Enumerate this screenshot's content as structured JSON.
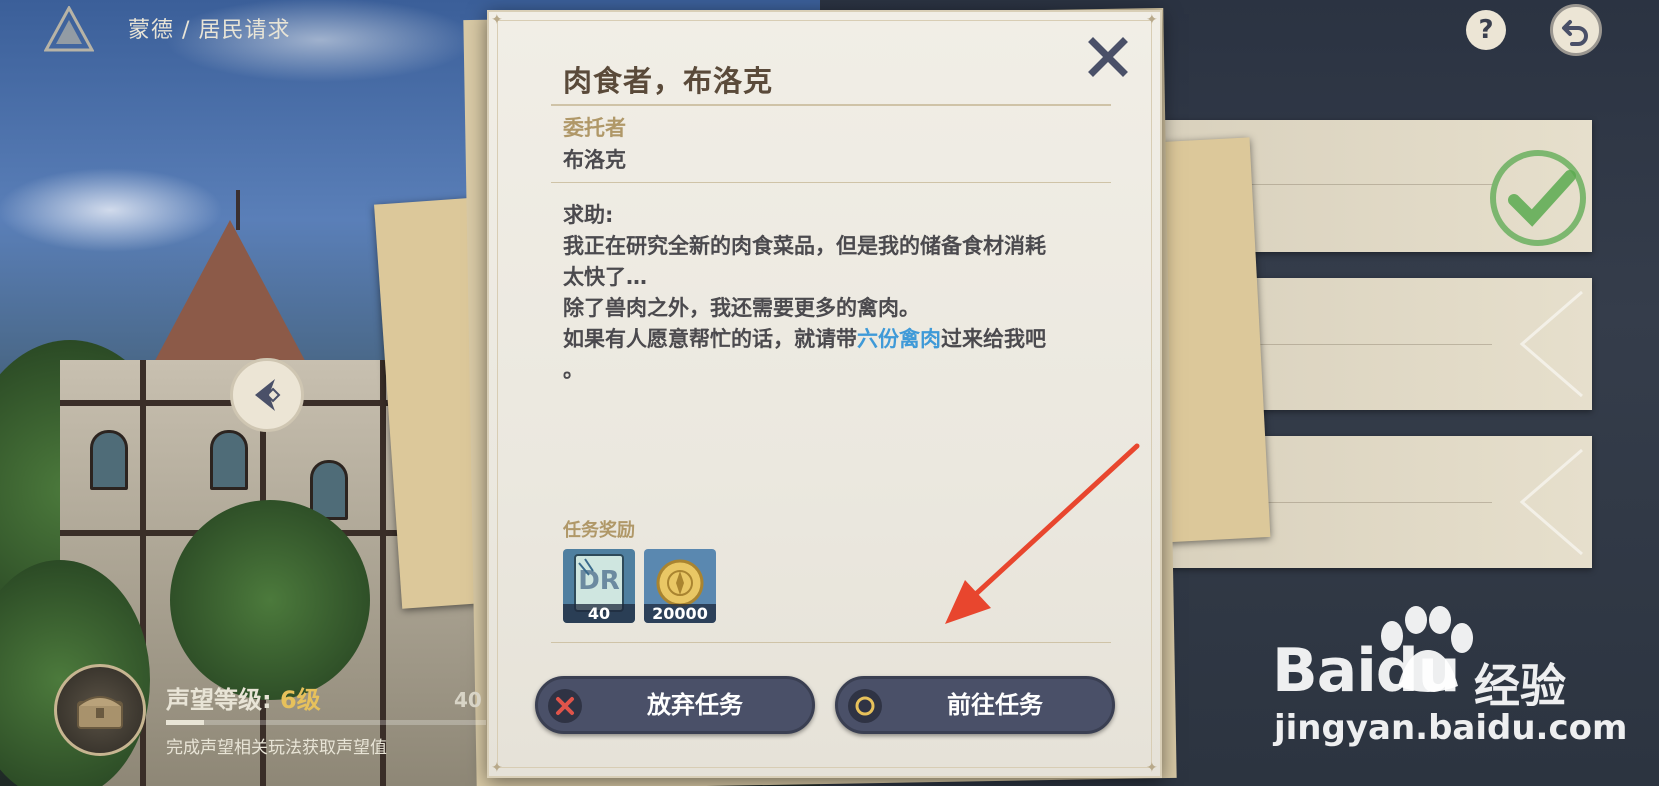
{
  "header": {
    "breadcrumb_region": "蒙德",
    "breadcrumb_separator": "/",
    "breadcrumb_page": "居民请求"
  },
  "dialog": {
    "title": "肉食者，布洛克",
    "client_label": "委托者",
    "client_name": "布洛克",
    "description": {
      "line1": "求助:",
      "line2": "我正在研究全新的肉食菜品，但是我的储备食材消耗",
      "line3": "太快了…",
      "line4": "除了兽肉之外，我还需要更多的禽肉。",
      "line5_before": "如果有人愿意帮忙的话，就请带",
      "line5_highlight": "六份禽肉",
      "line5_after": "过来给我吧",
      "line6": "。"
    },
    "reward_label": "任务奖励",
    "rewards": [
      {
        "icon": "reputation-card-icon",
        "quantity": "40"
      },
      {
        "icon": "mora-coin-icon",
        "quantity": "20000"
      }
    ],
    "abandon_button": "放弃任务",
    "goto_button": "前往任务"
  },
  "reputation": {
    "label": "声望等级: ",
    "level": "6级",
    "points": "40",
    "progress_fraction": 0.12,
    "hint": "完成声望相关玩法获取声望值"
  },
  "watermark": {
    "word": "Bai",
    "word2": "du",
    "cn": "经验",
    "url": "jingyan.baidu.com"
  },
  "colors": {
    "highlight": "#3f9ad8",
    "button_bg": "#4a5068",
    "level_gold": "#e7c15b",
    "annotation_red": "#e8462e"
  }
}
